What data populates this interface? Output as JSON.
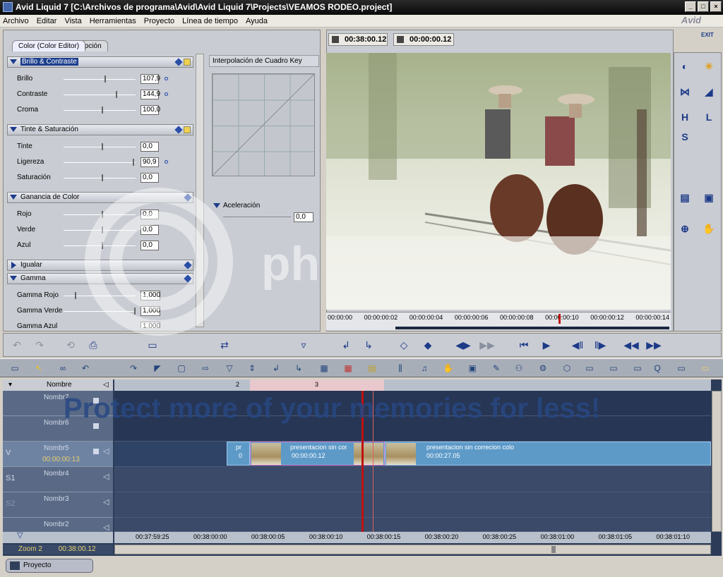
{
  "window": {
    "title": "Avid Liquid 7 [C:\\Archivos de programa\\Avid\\Avid Liquid 7\\Projects\\VEAMOS RODEO.project]",
    "brand": "Avid"
  },
  "menu": [
    "Archivo",
    "Editar",
    "Vista",
    "Herramientas",
    "Proyecto",
    "Línea de tiempo",
    "Ayuda"
  ],
  "editor": {
    "tabs": [
      "Color (Color Editor)",
      "Opción"
    ],
    "sections": {
      "brillo": {
        "title": "Brillo & Contraste",
        "params": [
          {
            "label": "Brillo",
            "value": "107,9"
          },
          {
            "label": "Contraste",
            "value": "144,9"
          },
          {
            "label": "Croma",
            "value": "100,0"
          }
        ]
      },
      "tinte": {
        "title": "Tinte & Saturación",
        "params": [
          {
            "label": "Tinte",
            "value": "0,0"
          },
          {
            "label": "Ligereza",
            "value": "90,9"
          },
          {
            "label": "Saturación",
            "value": "0,0"
          }
        ]
      },
      "ganancia": {
        "title": "Ganancia de Color",
        "params": [
          {
            "label": "Rojo",
            "value": "0,0"
          },
          {
            "label": "Verde",
            "value": "0,0"
          },
          {
            "label": "Azul",
            "value": "0,0"
          }
        ]
      },
      "igualar": {
        "title": "Igualar"
      },
      "gamma": {
        "title": "Gamma",
        "params": [
          {
            "label": "Gamma Rojo",
            "value": "1,000"
          },
          {
            "label": "Gamma Verde",
            "value": "1,000"
          },
          {
            "label": "Gamma Azul",
            "value": "1,000"
          }
        ]
      }
    },
    "interp_title": "Interpolación de Cuadro Key",
    "accel_label": "Aceleración",
    "accel_value": "0,0"
  },
  "viewer": {
    "tc_position": "00:38:00.12",
    "tc_duration": "00:00:00.12",
    "ruler_labels": [
      "00:00:00",
      "00:00:00:02",
      "00:00:00:04",
      "00:00:00:06",
      "00:00:00:08",
      "00:00:00:10",
      "00:00:00:12",
      "00:00:00:14"
    ],
    "exit_label": "EXIT"
  },
  "timeline": {
    "header_label": "Nombre",
    "tracks": [
      {
        "name": "Nombr7",
        "tag": ""
      },
      {
        "name": "Nombr6",
        "tag": ""
      },
      {
        "name": "Nombr5",
        "tag": "V",
        "tc": "00:00:00:13"
      },
      {
        "name": "Nombr4",
        "tag": "S1"
      },
      {
        "name": "Nombr3",
        "tag": "S2"
      },
      {
        "name": "Nombr2",
        "tag": ""
      }
    ],
    "top_markers": [
      "2",
      "3"
    ],
    "clips": [
      {
        "title": "pr",
        "tc": "0"
      },
      {
        "title": "presentacion sin cor",
        "tc": "00:00:00.12"
      },
      {
        "title": "presentacion sin correcion colo",
        "tc": "00:00:27.05"
      }
    ],
    "bottom_ruler": [
      "00:37:59:25",
      "00:38:00:00",
      "00:38:00:05",
      "00:38:00:10",
      "00:38:00:15",
      "00:38:00:20",
      "00:38:00:25",
      "00:38:01:00",
      "00:38:01:05",
      "00:38:01:10"
    ],
    "zoom_label": "Zoom  2",
    "zoom_tc": "00:38:00.12"
  },
  "status": {
    "project_button": "Proyecto"
  },
  "overlay": {
    "watermark": "ph",
    "banner": "Protect more of your memories for less!"
  }
}
